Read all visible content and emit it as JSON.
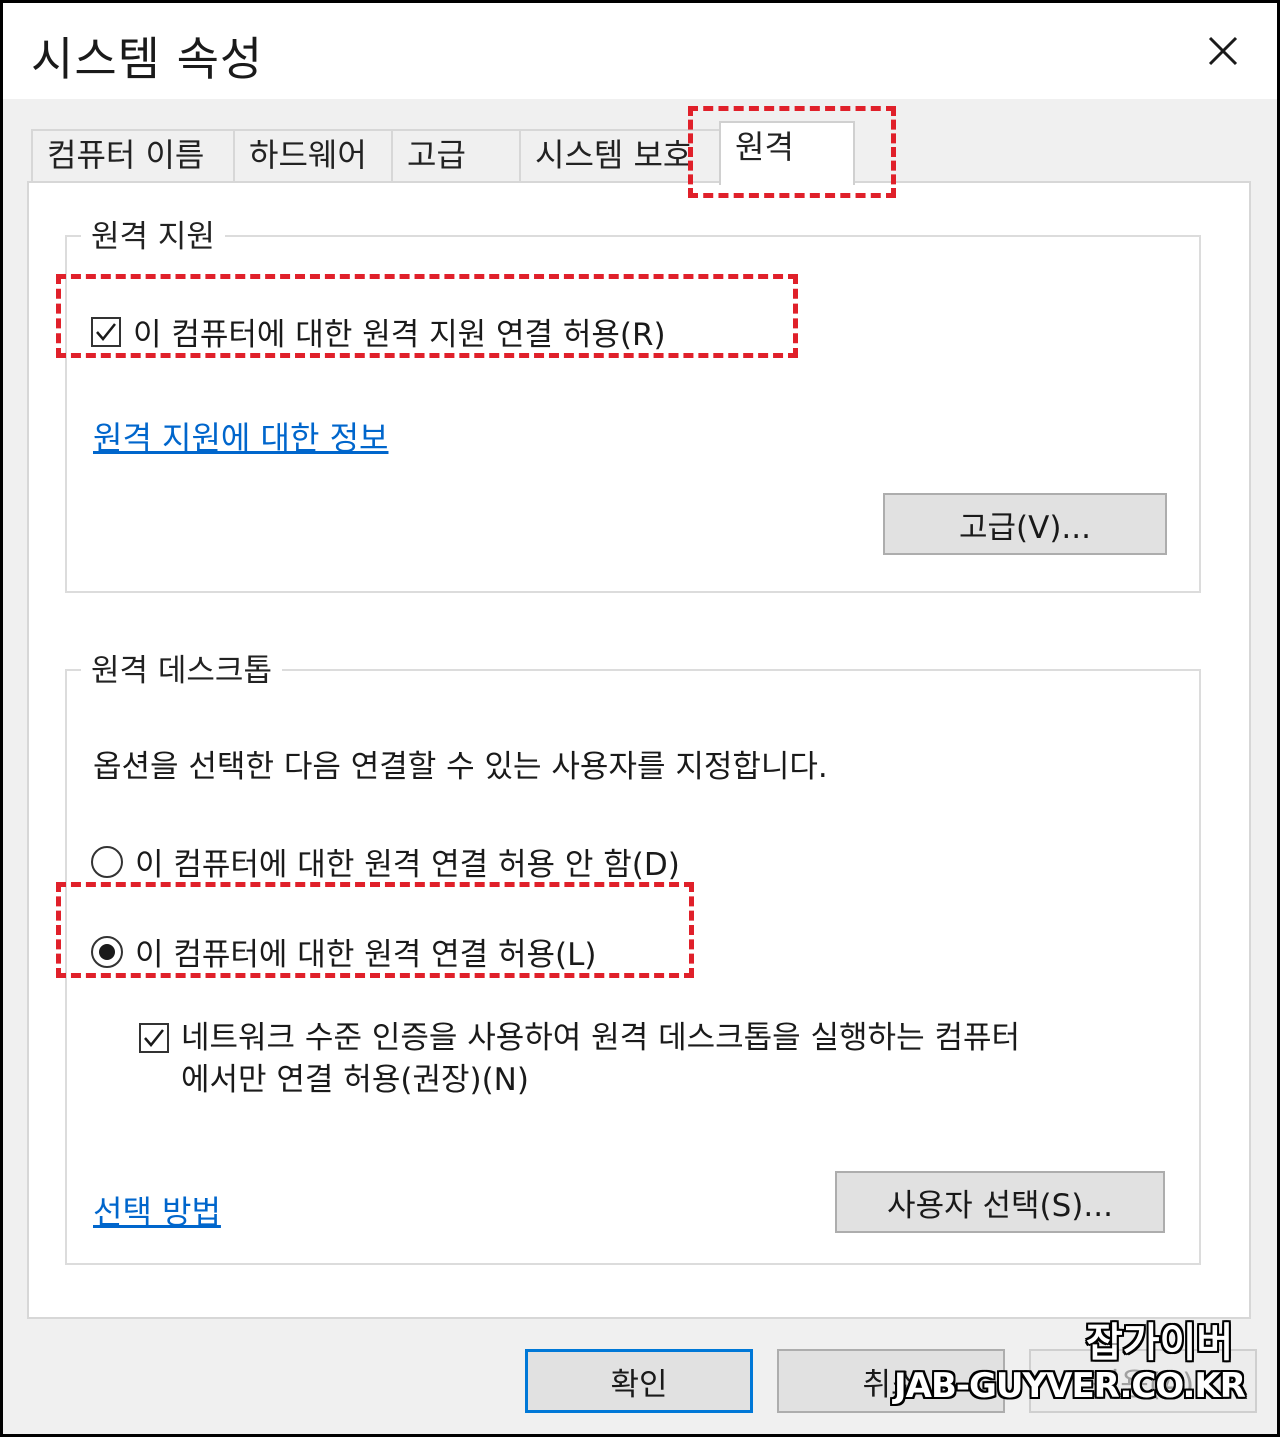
{
  "window": {
    "title": "시스템 속성"
  },
  "tabs": [
    {
      "label": "컴퓨터 이름"
    },
    {
      "label": "하드웨어"
    },
    {
      "label": "고급"
    },
    {
      "label": "시스템 보호"
    },
    {
      "label": "원격",
      "active": true
    }
  ],
  "remote_assistance": {
    "group_title": "원격 지원",
    "allow_checkbox": {
      "label": "이 컴퓨터에 대한 원격 지원 연결 허용(R)",
      "checked": true
    },
    "info_link": "원격 지원에 대한 정보",
    "advanced_button": "고급(V)..."
  },
  "remote_desktop": {
    "group_title": "원격 데스크톱",
    "description": "옵션을 선택한 다음 연결할 수 있는 사용자를 지정합니다.",
    "radio_deny": {
      "label": "이 컴퓨터에 대한 원격 연결 허용 안 함(D)",
      "selected": false
    },
    "radio_allow": {
      "label": "이 컴퓨터에 대한 원격 연결 허용(L)",
      "selected": true
    },
    "nla_checkbox": {
      "label_line1": "네트워크 수준 인증을 사용하여 원격 데스크톱을 실행하는 컴퓨터",
      "label_line2": "에서만 연결 허용(권장)(N)",
      "checked": true
    },
    "help_link": "선택 방법",
    "select_users_button": "사용자 선택(S)..."
  },
  "footer": {
    "ok_button": "확인",
    "cancel_button": "취소",
    "apply_button": "적용(A)"
  },
  "watermark": {
    "korean": "잡가이버",
    "english": "JAB-GUYVER.CO.KR"
  },
  "colors": {
    "highlight": "#e0202a",
    "link": "#0066cc",
    "accent": "#0078d7"
  }
}
